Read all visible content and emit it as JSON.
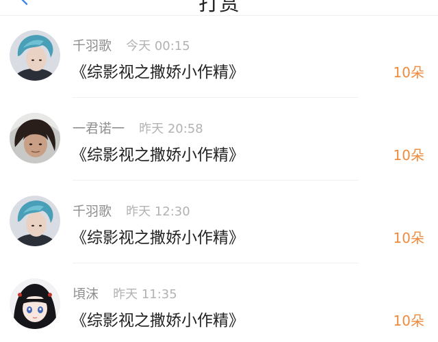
{
  "header": {
    "title": "打赏",
    "back_icon": "back-arrow-icon",
    "accent": "#3d86e8"
  },
  "accent_gift_color": "#f08a3c",
  "items": [
    {
      "avatar": "avatar-blue-hair-icon",
      "username": "千羽歌",
      "time": "今天 00:15",
      "title": "《综影视之撒娇小作精》",
      "gift": "10朵"
    },
    {
      "avatar": "avatar-photo-icon",
      "username": "一君诺一",
      "time": "昨天 20:58",
      "title": "《综影视之撒娇小作精》",
      "gift": "10朵"
    },
    {
      "avatar": "avatar-blue-hair-icon",
      "username": "千羽歌",
      "time": "昨天 12:30",
      "title": "《综影视之撒娇小作精》",
      "gift": "10朵"
    },
    {
      "avatar": "avatar-anime-girl-icon",
      "username": "頃沫",
      "time": "昨天 11:35",
      "title": "《综影视之撒娇小作精》",
      "gift": "10朵"
    }
  ]
}
